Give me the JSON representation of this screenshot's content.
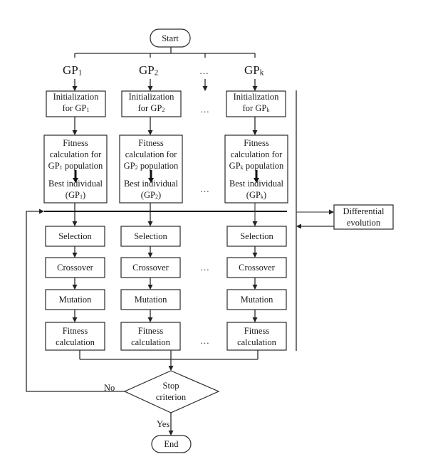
{
  "start": {
    "label": "Start"
  },
  "end": {
    "label": "End"
  },
  "columns": [
    {
      "id": "gp1",
      "gp_label": "GP",
      "gp_sub": "1",
      "init": {
        "line1": "Initialization",
        "line2_prefix": "for GP",
        "sub": "1"
      },
      "fitness_pop": {
        "line1": "Fitness",
        "line2": "calculation for",
        "line3_prefix": "GP",
        "sub": "1",
        "line3_suffix": " population",
        "line4": "Best individual",
        "line5_prefix": "(GP",
        "line5_suffix": ")"
      },
      "selection": "Selection",
      "crossover": "Crossover",
      "mutation": "Mutation",
      "fitness": {
        "line1": "Fitness",
        "line2": "calculation"
      }
    },
    {
      "id": "gp2",
      "gp_label": "GP",
      "gp_sub": "2",
      "init": {
        "line1": "Initialization",
        "line2_prefix": "for GP",
        "sub": "2"
      },
      "fitness_pop": {
        "line1": "Fitness",
        "line2": "calculation for",
        "line3_prefix": "GP",
        "sub": "2",
        "line3_suffix": " population",
        "line4": "Best individual",
        "line5_prefix": "(GP",
        "line5_suffix": ")"
      },
      "selection": "Selection",
      "crossover": "Crossover",
      "mutation": "Mutation",
      "fitness": {
        "line1": "Fitness",
        "line2": "calculation"
      }
    },
    {
      "id": "gpk",
      "gp_label": "GP",
      "gp_sub": "k",
      "init": {
        "line1": "Initialization",
        "line2_prefix": "for GP",
        "sub": "k"
      },
      "fitness_pop": {
        "line1": "Fitness",
        "line2": "calculation for",
        "line3_prefix": "GP",
        "sub": "k",
        "line3_suffix": " population",
        "line4": "Best individual",
        "line5_prefix": "(GP",
        "line5_suffix": ")"
      },
      "selection": "Selection",
      "crossover": "Crossover",
      "mutation": "Mutation",
      "fitness": {
        "line1": "Fitness",
        "line2": "calculation"
      }
    }
  ],
  "ellipsis": "…",
  "differential_evolution": {
    "line1": "Differential",
    "line2": "evolution"
  },
  "decision": {
    "line1": "Stop",
    "line2": "criterion",
    "no_label": "No",
    "yes_label": "Yes"
  }
}
